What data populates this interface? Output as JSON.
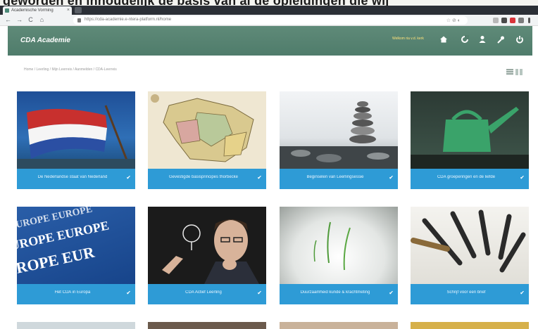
{
  "caption": "geworden en inhoudelijk de basis van al de opleidingen die wij",
  "browser": {
    "tab_title": "Academische Vorming",
    "tab_close": "×",
    "back": "←",
    "forward": "→",
    "reload": "C",
    "home": "⌂",
    "url": "https://cda-academie.e-ntera-platform.nl/home",
    "addr_icons": "☆  ⊘  ◐"
  },
  "header": {
    "logo": "CDA Academie",
    "user": "Welkom ria v.d. kerk",
    "icons": {
      "home": "home-icon",
      "refresh": "refresh-icon",
      "user": "user-icon",
      "tools": "wrench-icon",
      "power": "power-icon"
    },
    "colors": {
      "bar": "#5f8a78",
      "tile_label": "#2e9bd6"
    }
  },
  "breadcrumb": "Home  /  Leerling  /  Mijn  Leerreis  /  Aanmelden  /  CDA-Leerreis",
  "tiles": [
    {
      "label": "De Nederlandse staat van Nederland"
    },
    {
      "label": "Gevestigde basisprincipes thorbecke"
    },
    {
      "label": "Beginselen van Leerlingsessie"
    },
    {
      "label": "CDA groeperingen en de liefde"
    },
    {
      "label": "Het CDA in Europa"
    },
    {
      "label": "CDA Actief Leerling"
    },
    {
      "label": "Duurzaamheid kunde & krachtmeting"
    },
    {
      "label": "Schrijf voor een brief"
    }
  ]
}
